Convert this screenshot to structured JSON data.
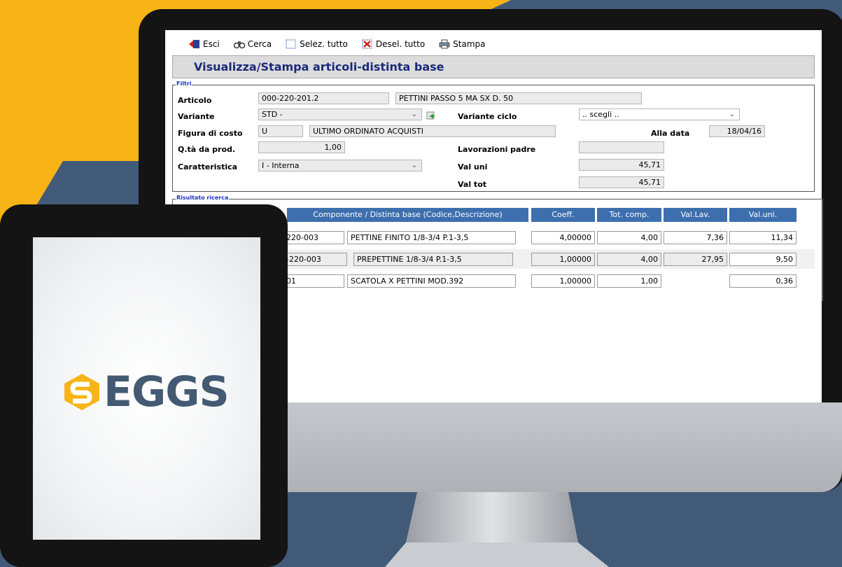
{
  "colors": {
    "background": "#415a77",
    "accent_yellow": "#f8b416",
    "header_blue": "#3d6fae",
    "title_blue": "#1a2a7a"
  },
  "toolbar": {
    "exit_label": "Esci",
    "search_label": "Cerca",
    "select_all_label": "Selez. tutto",
    "deselect_all_label": "Desel. tutto",
    "print_label": "Stampa"
  },
  "page_title": "Visualizza/Stampa articoli-distinta base",
  "filters": {
    "legend": "Filtri",
    "articolo_label": "Articolo",
    "articolo_code": "000-220-201.2",
    "articolo_desc": "PETTINI PASSO 5 MA SX D. 50",
    "variante_label": "Variante",
    "variante_value": "STD -",
    "variante_ciclo_label": "Variante ciclo",
    "variante_ciclo_value": ".. scegli ..",
    "figura_label": "Figura di costo",
    "figura_code": "U",
    "figura_desc": "ULTIMO ORDINATO ACQUISTI",
    "alla_data_label": "Alla data",
    "alla_data_value": "18/04/16",
    "qta_label": "Q.tà da prod.",
    "qta_value": "1,00",
    "lav_padre_label": "Lavorazioni padre",
    "lav_padre_value": "",
    "caratteristica_label": "Caratteristica",
    "caratteristica_value": "I - Interna",
    "val_uni_label": "Val uni",
    "val_uni_value": "45,71",
    "val_tot_label": "Val tot",
    "val_tot_value": "45,71"
  },
  "results": {
    "legend": "Risultato ricerca",
    "columns": [
      "Componente / Distinta base (Codice,Descrizione)",
      "Coeff.",
      "Tot. comp.",
      "Val.Lav.",
      "Val.uni."
    ],
    "rows": [
      {
        "code": "220-003",
        "desc": "PETTINE FINITO 1/8-3/4 P.1-3,5",
        "coeff": "4,00000",
        "tot": "4,00",
        "vallav": "7,36",
        "valuni": "11,34"
      },
      {
        "code": "-220-003",
        "desc": "PREPETTINE 1/8-3/4 P.1-3,5",
        "coeff": "1,00000",
        "tot": "4,00",
        "vallav": "27,95",
        "valuni": "9,50"
      },
      {
        "code": "01",
        "desc": "SCATOLA X PETTINI MOD.392",
        "coeff": "1,00000",
        "tot": "1,00",
        "vallav": "",
        "valuni": "0,36"
      }
    ]
  },
  "logo": {
    "text": "EGGS"
  }
}
